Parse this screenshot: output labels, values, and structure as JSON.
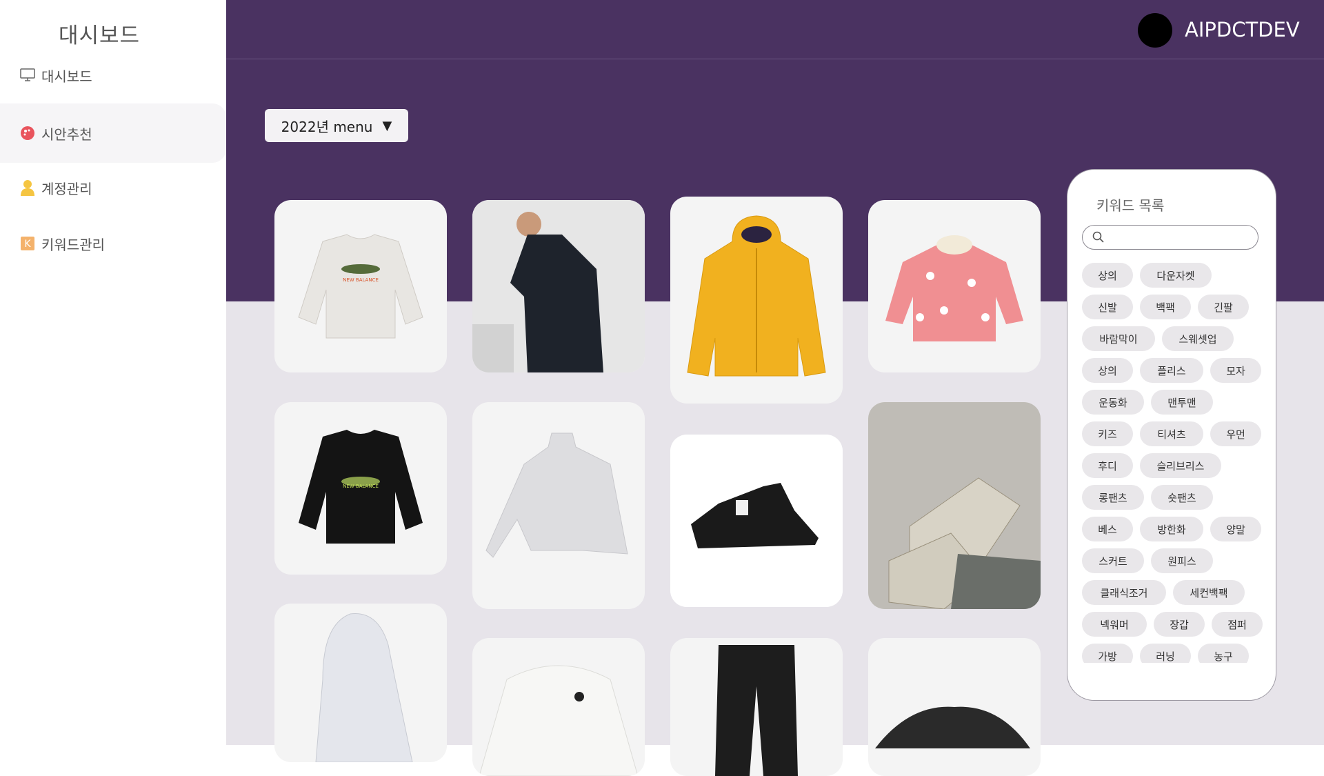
{
  "sidebar": {
    "brand": "대시보드",
    "items": [
      {
        "label": "대시보드",
        "icon": "monitor-icon"
      },
      {
        "label": "시안추천",
        "icon": "palette-icon"
      },
      {
        "label": "계정관리",
        "icon": "user-icon"
      },
      {
        "label": "키워드관리",
        "icon": "keyword-k-icon"
      }
    ]
  },
  "header": {
    "username": "AIPDCTDEV"
  },
  "menu_select": {
    "label": "2022년 menu",
    "caret": "▼"
  },
  "products": [
    {
      "name": "흰색 UFO 스웨트셔츠"
    },
    {
      "name": "네이비 후드 다운자켓 모델"
    },
    {
      "name": "옐로우 후드 자켓"
    },
    {
      "name": "핑크 패턴 패딩"
    },
    {
      "name": "블랙 UFO 스웨트셔츠"
    },
    {
      "name": "그레이 하이넥 스웨트셔츠"
    },
    {
      "name": "블랙 패딩 부츠"
    },
    {
      "name": "베이지 러닝화"
    },
    {
      "name": "화이트 후드 패딩"
    },
    {
      "name": "화이트 맨투맨"
    },
    {
      "name": "블랙 카고팬츠"
    },
    {
      "name": "블랙 슬라이드"
    }
  ],
  "keywords": {
    "title": "키워드 목록",
    "search_placeholder": "",
    "chips": [
      "상의",
      "다운자켓",
      "신발",
      "백팩",
      "긴팔",
      "바람막이",
      "스웨셋업",
      "상의",
      "플리스",
      "모자",
      "운동화",
      "맨투맨",
      "키즈",
      "티셔츠",
      "우먼",
      "후디",
      "슬리브리스",
      "롱팬츠",
      "숏팬츠",
      "베스",
      "방한화",
      "양말",
      "스커트",
      "원피스",
      "클래식조거",
      "세컨백팩",
      "넥워머",
      "장갑",
      "점퍼",
      "가방",
      "러닝",
      "농구"
    ]
  },
  "colors": {
    "header_bg": "#4a3261",
    "main_bg": "#e7e4ea",
    "card_bg": "#f4f4f4",
    "chip_bg": "#e9e7ea"
  }
}
